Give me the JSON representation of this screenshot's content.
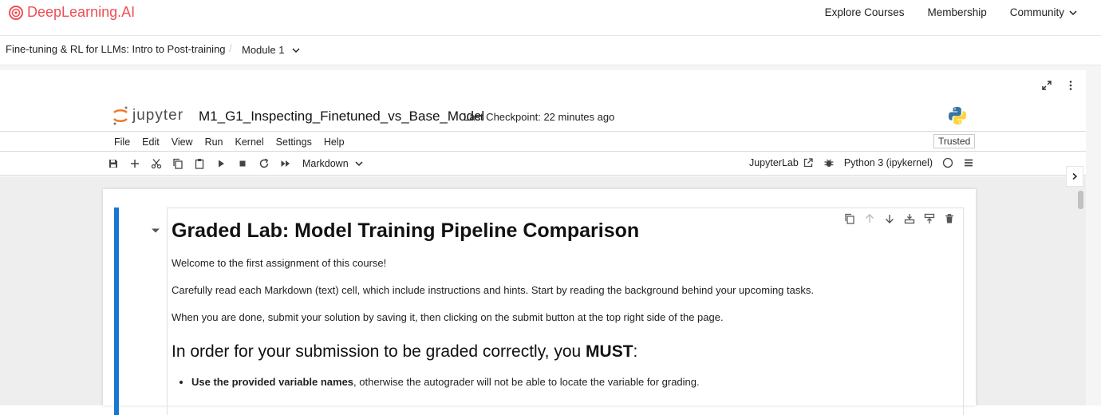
{
  "site": {
    "brand": "DeepLearning.AI",
    "nav": [
      "Explore Courses",
      "Membership",
      "Community"
    ]
  },
  "breadcrumb": {
    "course": "Fine-tuning & RL for LLMs: Intro to Post-training",
    "separator": "/",
    "module": "Module 1"
  },
  "jupyter": {
    "logo_text": "jupyter",
    "notebook_name": "M1_G1_Inspecting_Finetuned_vs_Base_Model",
    "checkpoint": "Last Checkpoint: 22 minutes ago",
    "menus": [
      "File",
      "Edit",
      "View",
      "Run",
      "Kernel",
      "Settings",
      "Help"
    ],
    "trusted": "Trusted",
    "cell_type": "Markdown",
    "jupyterlab_link": "JupyterLab",
    "kernel_name": "Python 3 (ipykernel)"
  },
  "cell": {
    "title": "Graded Lab: Model Training Pipeline Comparison",
    "p1": "Welcome to the first assignment of this course!",
    "p2": "Carefully read each Markdown (text) cell, which include instructions and hints. Start by reading the background behind your upcoming tasks.",
    "p3": "When you are done, submit your solution by saving it, then clicking on the submit button at the top right side of the page.",
    "h2_prefix": "In order for your submission to be graded correctly, you ",
    "h2_bold": "MUST",
    "h2_suffix": ":",
    "bullet1_bold": "Use the provided variable names",
    "bullet1_rest": ", otherwise the autograder will not be able to locate the variable for grading."
  },
  "colors": {
    "brand": "#ef4f56",
    "active_cell": "#1976d2",
    "jupyter_orange": "#f37726"
  }
}
